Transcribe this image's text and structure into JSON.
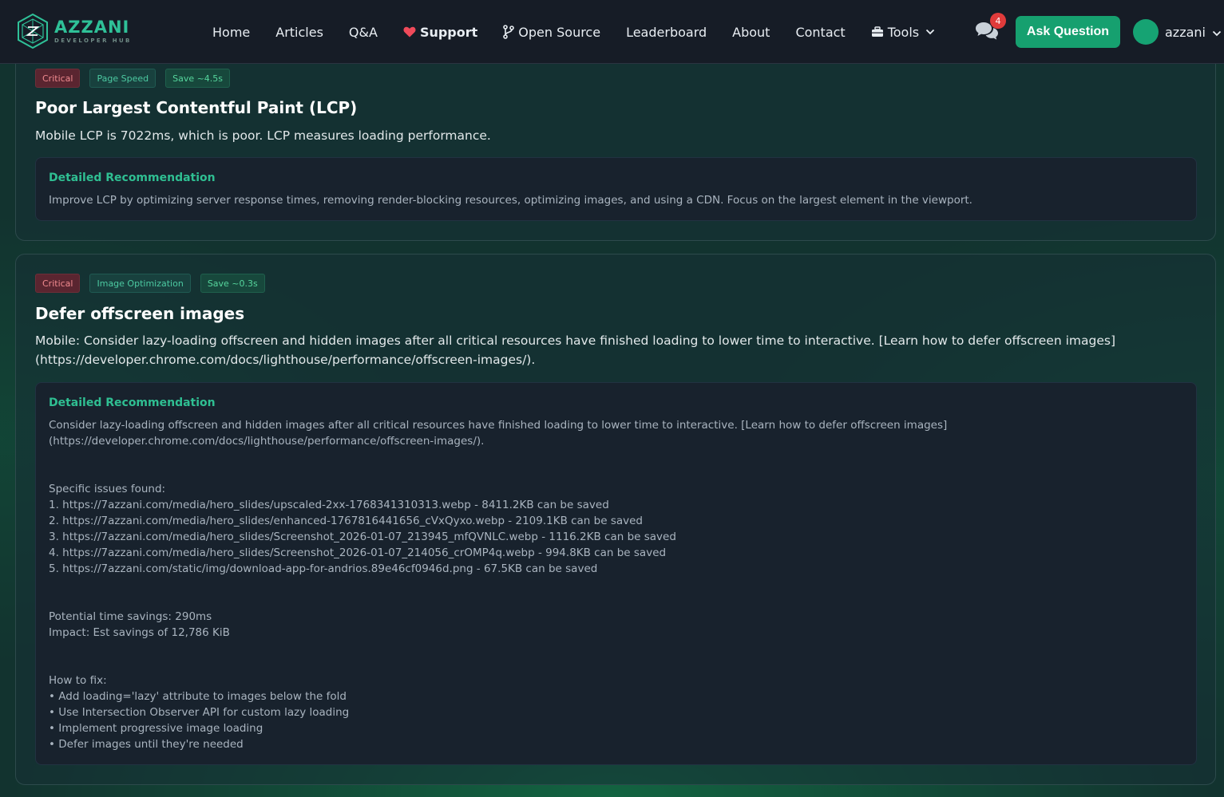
{
  "brand": {
    "name": "AZZANI",
    "subtitle": "DEVELOPER HUB"
  },
  "nav": {
    "home": "Home",
    "articles": "Articles",
    "qa": "Q&A",
    "support": "Support",
    "open_source": "Open Source",
    "leaderboard": "Leaderboard",
    "about": "About",
    "contact": "Contact",
    "tools": "Tools"
  },
  "header": {
    "message_count": "4",
    "ask_button": "Ask Question",
    "username": "azzani"
  },
  "issues": [
    {
      "severity": "Critical",
      "category": "Page Speed",
      "savings": "Save ~4.5s",
      "title": "Poor Largest Contentful Paint (LCP)",
      "description": "Mobile LCP is 7022ms, which is poor. LCP measures loading performance.",
      "recommendation_heading": "Detailed Recommendation",
      "recommendation": "Improve LCP by optimizing server response times, removing render-blocking resources, optimizing images, and using a CDN. Focus on the largest element in the viewport."
    },
    {
      "severity": "Critical",
      "category": "Image Optimization",
      "savings": "Save ~0.3s",
      "title": "Defer offscreen images",
      "description": "Mobile: Consider lazy-loading offscreen and hidden images after all critical resources have finished loading to lower time to interactive. [Learn how to defer offscreen images](https://developer.chrome.com/docs/lighthouse/performance/offscreen-images/).",
      "recommendation_heading": "Detailed Recommendation",
      "recommendation_intro": "Consider lazy-loading offscreen and hidden images after all critical resources have finished loading to lower time to interactive. [Learn how to defer offscreen images](https://developer.chrome.com/docs/lighthouse/performance/offscreen-images/).",
      "issues_heading": "Specific issues found:",
      "issues_list": [
        "1. https://7azzani.com/media/hero_slides/upscaled-2xx-1768341310313.webp - 8411.2KB can be saved",
        "2. https://7azzani.com/media/hero_slides/enhanced-1767816441656_cVxQyxo.webp - 2109.1KB can be saved",
        "3. https://7azzani.com/media/hero_slides/Screenshot_2026-01-07_213945_mfQVNLC.webp - 1116.2KB can be saved",
        "4. https://7azzani.com/media/hero_slides/Screenshot_2026-01-07_214056_crOMP4q.webp - 994.8KB can be saved",
        "5. https://7azzani.com/static/img/download-app-for-andrios.89e46cf0946d.png - 67.5KB can be saved"
      ],
      "time_savings": "Potential time savings: 290ms",
      "impact": "Impact: Est savings of 12,786 KiB",
      "fix_heading": "How to fix:",
      "fix_list": [
        "• Add loading='lazy' attribute to images below the fold",
        "• Use Intersection Observer API for custom lazy loading",
        "• Implement progressive image loading",
        "• Defer images until they're needed"
      ]
    }
  ]
}
